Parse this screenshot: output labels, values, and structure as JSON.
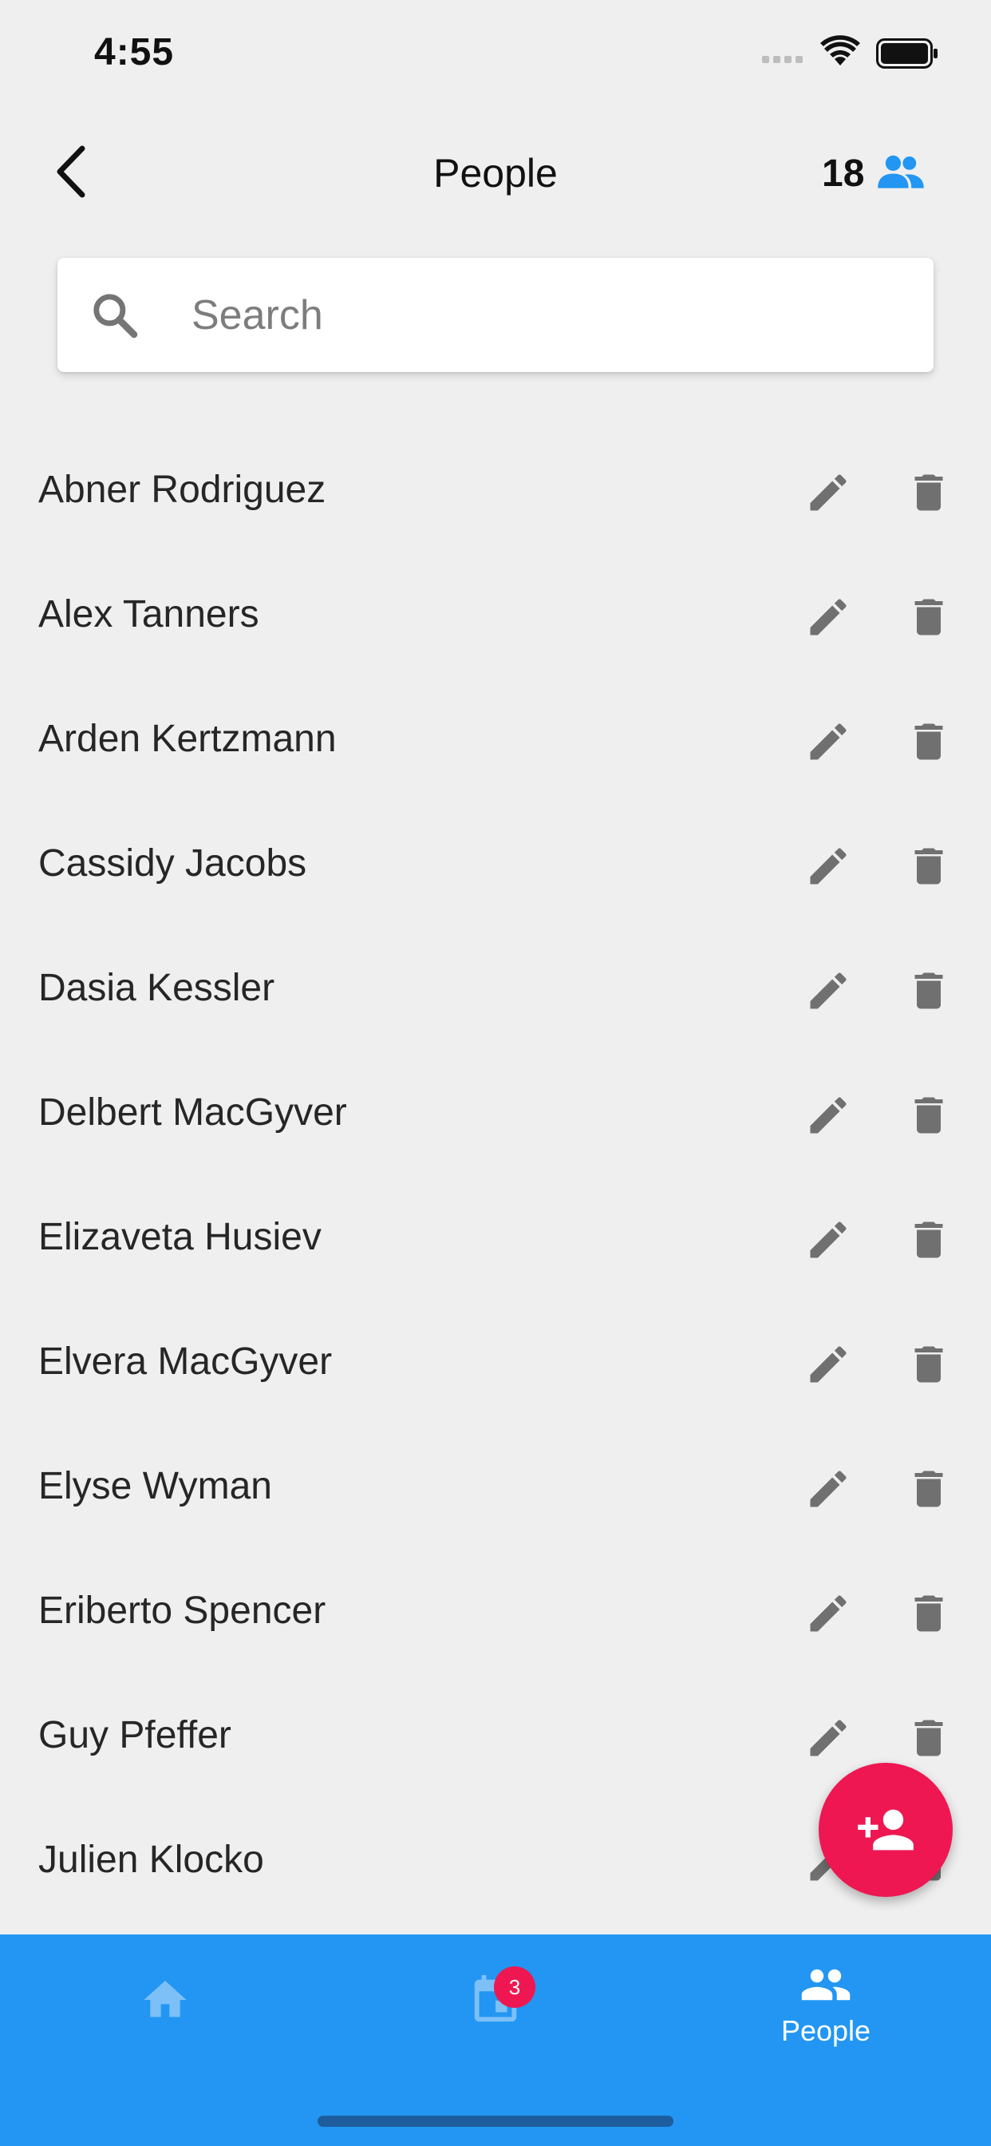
{
  "status_bar": {
    "time": "4:55"
  },
  "header": {
    "title": "People",
    "count": "18"
  },
  "search": {
    "placeholder": "Search",
    "value": ""
  },
  "people": [
    {
      "name": "Abner Rodriguez"
    },
    {
      "name": "Alex Tanners"
    },
    {
      "name": "Arden Kertzmann"
    },
    {
      "name": "Cassidy Jacobs"
    },
    {
      "name": "Dasia Kessler"
    },
    {
      "name": "Delbert MacGyver"
    },
    {
      "name": "Elizaveta Husiev"
    },
    {
      "name": "Elvera MacGyver"
    },
    {
      "name": "Elyse Wyman"
    },
    {
      "name": "Eriberto Spencer"
    },
    {
      "name": "Guy Pfeffer"
    },
    {
      "name": "Julien Klocko"
    }
  ],
  "bottom_nav": {
    "items": [
      {
        "id": "home",
        "icon": "home-icon",
        "label": ""
      },
      {
        "id": "calendar",
        "icon": "calendar-icon",
        "label": "",
        "badge": "3"
      },
      {
        "id": "people",
        "icon": "people-icon",
        "label": "People",
        "active": true
      }
    ]
  },
  "colors": {
    "accent": "#2296F2",
    "fab": "#EE1752",
    "background": "#EFEFEF",
    "icon_gray": "#757575"
  }
}
